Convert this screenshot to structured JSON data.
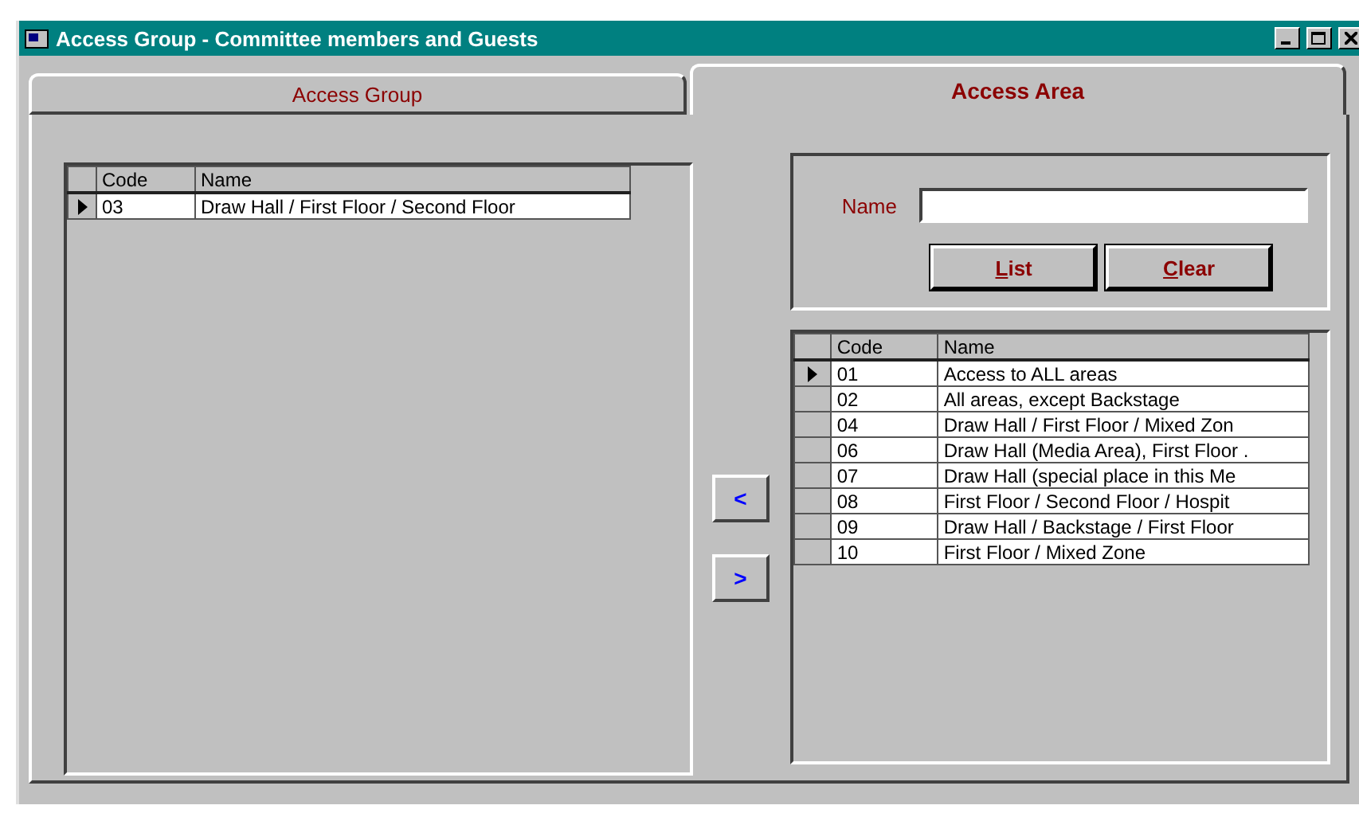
{
  "window": {
    "title": "Access Group - Committee members and Guests"
  },
  "tabs": [
    {
      "label": "Access Group",
      "selected": false
    },
    {
      "label": "Access Area",
      "selected": true
    }
  ],
  "group_table": {
    "columns": [
      "Code",
      "Name"
    ],
    "rows": [
      {
        "code": "03",
        "name": "Draw Hall / First Floor / Second Floor",
        "selected": true
      }
    ]
  },
  "search": {
    "label": "Name"
  },
  "buttons": [
    {
      "label": "List"
    },
    {
      "label": "Clear"
    }
  ],
  "move_buttons": [
    "<",
    ">"
  ],
  "area_table": {
    "columns": [
      "Code",
      "Name"
    ],
    "rows": [
      {
        "code": "01",
        "name": "Access to ALL areas",
        "selected": true
      },
      {
        "code": "02",
        "name": "All areas, except Backstage",
        "selected": false
      },
      {
        "code": "04",
        "name": "Draw Hall / First Floor / Mixed Zon",
        "selected": false
      },
      {
        "code": "06",
        "name": "Draw Hall (Media Area), First Floor .",
        "selected": false
      },
      {
        "code": "07",
        "name": "Draw Hall (special place in this Me",
        "selected": false
      },
      {
        "code": "08",
        "name": "First Floor / Second Floor / Hospit",
        "selected": false
      },
      {
        "code": "09",
        "name": "Draw Hall / Backstage / First Floor",
        "selected": false
      },
      {
        "code": "10",
        "name": "First Floor / Mixed Zone",
        "selected": false
      }
    ]
  }
}
